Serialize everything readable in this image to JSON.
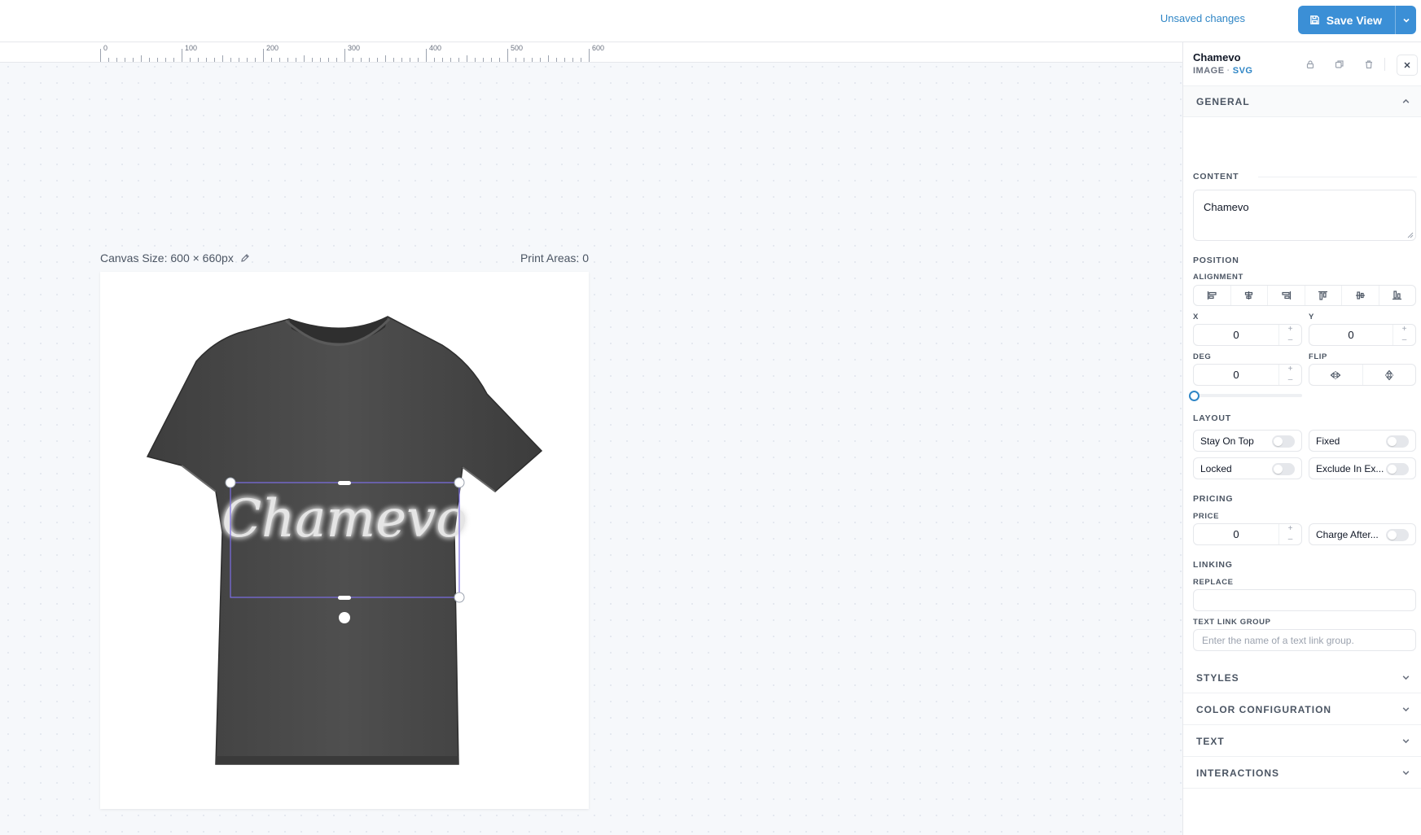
{
  "header": {
    "unsaved_label": "Unsaved changes",
    "save_label": "Save View",
    "accent": "#3b8fd6"
  },
  "ruler": {
    "ticks": [
      "0",
      "100",
      "200",
      "300",
      "400",
      "500",
      "600"
    ]
  },
  "canvas": {
    "size_label": "Canvas Size: 600 × 660px",
    "print_areas_label": "Print Areas: 0",
    "selected_text": "Chamevo",
    "shirt_color": "#4a4a4a"
  },
  "panel": {
    "title": "Chamevo",
    "type": "IMAGE",
    "format": "SVG",
    "icons": [
      "lock-icon",
      "duplicate-icon",
      "trash-icon",
      "close-icon"
    ],
    "general": {
      "label": "GENERAL",
      "content_label": "CONTENT",
      "content_value": "Chamevo",
      "position_label": "POSITION",
      "alignment_label": "ALIGNMENT",
      "x_label": "X",
      "x_value": "0",
      "y_label": "Y",
      "y_value": "0",
      "deg_label": "DEG",
      "deg_value": "0",
      "flip_label": "FLIP",
      "layout_label": "LAYOUT",
      "toggles": {
        "stay_on_top": "Stay On Top",
        "fixed": "Fixed",
        "locked": "Locked",
        "exclude": "Exclude In Ex..."
      },
      "pricing_label": "PRICING",
      "price_label": "PRICE",
      "price_value": "0",
      "charge_after": "Charge After...",
      "linking_label": "LINKING",
      "replace_label": "REPLACE",
      "replace_value": "",
      "text_link_group_label": "TEXT LINK GROUP",
      "text_link_group_placeholder": "Enter the name of a text link group."
    },
    "sections": {
      "styles": "STYLES",
      "color_configuration": "COLOR CONFIGURATION",
      "text": "TEXT",
      "interactions": "INTERACTIONS"
    },
    "step_plus": "+",
    "step_minus": "–"
  }
}
